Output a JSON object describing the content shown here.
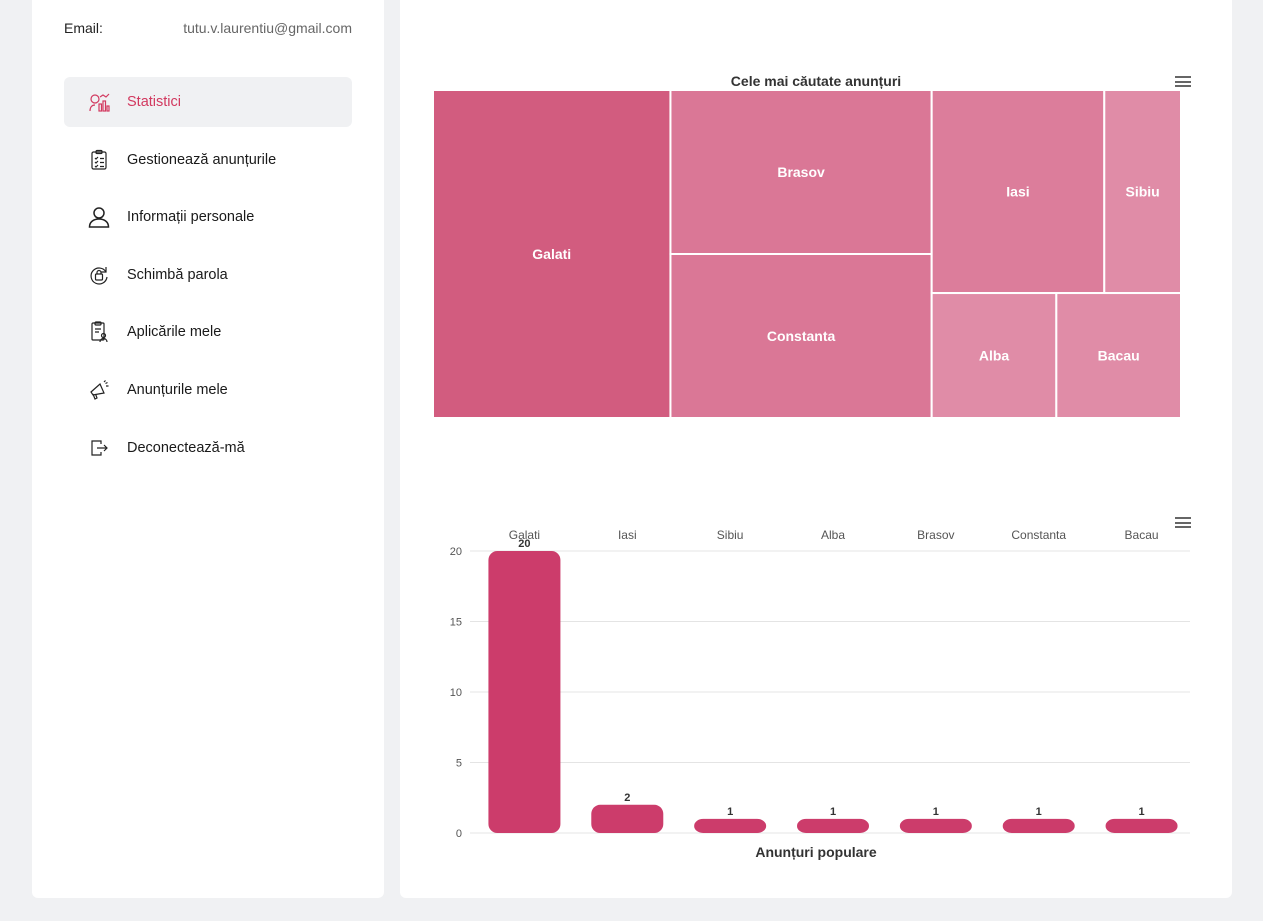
{
  "profile": {
    "email_label": "Email:",
    "email_value": "tutu.v.laurentiu@gmail.com"
  },
  "menu": [
    {
      "label": "Statistici",
      "icon": "statistics-icon",
      "active": true
    },
    {
      "label": "Gestionează anunțurile",
      "icon": "clipboard-checklist-icon"
    },
    {
      "label": "Informații personale",
      "icon": "user-icon"
    },
    {
      "label": "Schimbă parola",
      "icon": "lock-refresh-icon"
    },
    {
      "label": "Aplicările mele",
      "icon": "document-user-icon"
    },
    {
      "label": "Anunțurile mele",
      "icon": "megaphone-icon"
    },
    {
      "label": "Deconectează-mă",
      "icon": "logout-icon"
    }
  ],
  "colors": {
    "accent": "#d2395f",
    "bar": "#cc3c6b"
  },
  "chart_data": [
    {
      "type": "treemap",
      "title": "Cele mai căutate anunțuri",
      "items": [
        {
          "name": "Galati",
          "value": 20
        },
        {
          "name": "Brasov",
          "value": 11
        },
        {
          "name": "Constanta",
          "value": 11
        },
        {
          "name": "Iasi",
          "value": 9
        },
        {
          "name": "Alba",
          "value": 4
        },
        {
          "name": "Bacau",
          "value": 4
        },
        {
          "name": "Sibiu",
          "value": 4
        }
      ]
    },
    {
      "type": "bar",
      "title": "Anunțuri populare",
      "categories": [
        "Galati",
        "Iasi",
        "Sibiu",
        "Alba",
        "Brasov",
        "Constanta",
        "Bacau"
      ],
      "values": [
        20,
        2,
        1,
        1,
        1,
        1,
        1
      ],
      "yticks": [
        0,
        5,
        10,
        15,
        20
      ],
      "ylim": [
        0,
        20
      ],
      "xaxis_position": "top",
      "grid": true
    }
  ]
}
